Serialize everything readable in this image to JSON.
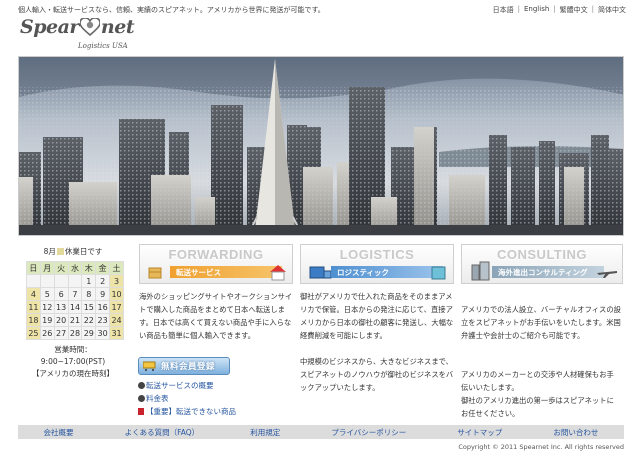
{
  "header": {
    "tagline": "個人輸入・転送サービスなら、信頼、実績のスピアネット。アメリカから世界に発送が可能です。",
    "languages": [
      "日本語",
      "English",
      "繁體中文",
      "简体中文"
    ],
    "logo": {
      "main_left": "Spear",
      "main_right": "net",
      "sub": "Logistics USA"
    }
  },
  "colors": {
    "link": "#2555a0",
    "forwarding_strip": "#f0a030",
    "logistics_strip": "#4d8fd0",
    "consulting_strip": "#8aa4b8",
    "holiday": "#eee4a8"
  },
  "sidebar": {
    "holiday_month": "8月",
    "holiday_suffix": "休業日です",
    "weekdays": [
      "日",
      "月",
      "火",
      "水",
      "木",
      "金",
      "土"
    ],
    "weeks": [
      [
        "",
        "",
        "",
        "",
        "1",
        "2",
        "3"
      ],
      [
        "4",
        "5",
        "6",
        "7",
        "8",
        "9",
        "10"
      ],
      [
        "11",
        "12",
        "13",
        "14",
        "15",
        "16",
        "17"
      ],
      [
        "18",
        "19",
        "20",
        "21",
        "22",
        "23",
        "24"
      ],
      [
        "25",
        "26",
        "27",
        "28",
        "29",
        "30",
        "31"
      ]
    ],
    "holidays": [
      "3",
      "4",
      "10",
      "11",
      "17",
      "18",
      "24",
      "25",
      "31"
    ],
    "hours_label": "営業時間：",
    "hours": "9:00~17:00(PST)",
    "hours_note": "【アメリカの現在時刻】"
  },
  "services": [
    {
      "title": "FORWARDING",
      "subtitle": "転送サービス",
      "icon": "package-arrow-house-icon"
    },
    {
      "title": "LOGISTICS",
      "subtitle": "ロジスティック",
      "icon": "truck-box-icon"
    },
    {
      "title": "CONSULTING",
      "subtitle": "海外進出コンサルティング",
      "icon": "building-airplane-icon"
    }
  ],
  "columns": {
    "forwarding": [
      "海外のショッピングサイトやオークションサイトで購入した商品をまとめて日本へ転送します。日本では高くて買えない商品や手に入らない商品も簡単に個人輸入できます。"
    ],
    "logistics": [
      "御社がアメリカで仕入れた商品をそのままアメリカで保管。日本からの発注に応じて、直接アメリカから日本の御社の顧客に発送し、大幅な経費削減を可能にします。",
      "中規模のビジネスから、大きなビジネスまで、スピアネットのノウハウが御社のビジネスをバックアップいたします。"
    ],
    "consulting": [
      "アメリカでの法人設立、バーチャルオフィスの設立をスピアネットがお手伝いをいたします。米国弁護士や会計士のご紹介も可能です。",
      "アメリカのメーカーとの交渉や人材確保もお手伝いいたします。\n御社のアメリカ進出の第一歩はスピアネットにお任せください。"
    ]
  },
  "signup_button": "無料会員登録",
  "links": [
    "転送サービスの概要",
    "料金表",
    "【重要】転送できない商品"
  ],
  "footer": {
    "nav": [
      "会社概要",
      "よくある質問（FAQ）",
      "利用規定",
      "プライバシーポリシー",
      "サイトマップ",
      "お問い合わせ"
    ],
    "copyright": "Copyright © 2011 Spearnet Inc. All rights reserved"
  }
}
